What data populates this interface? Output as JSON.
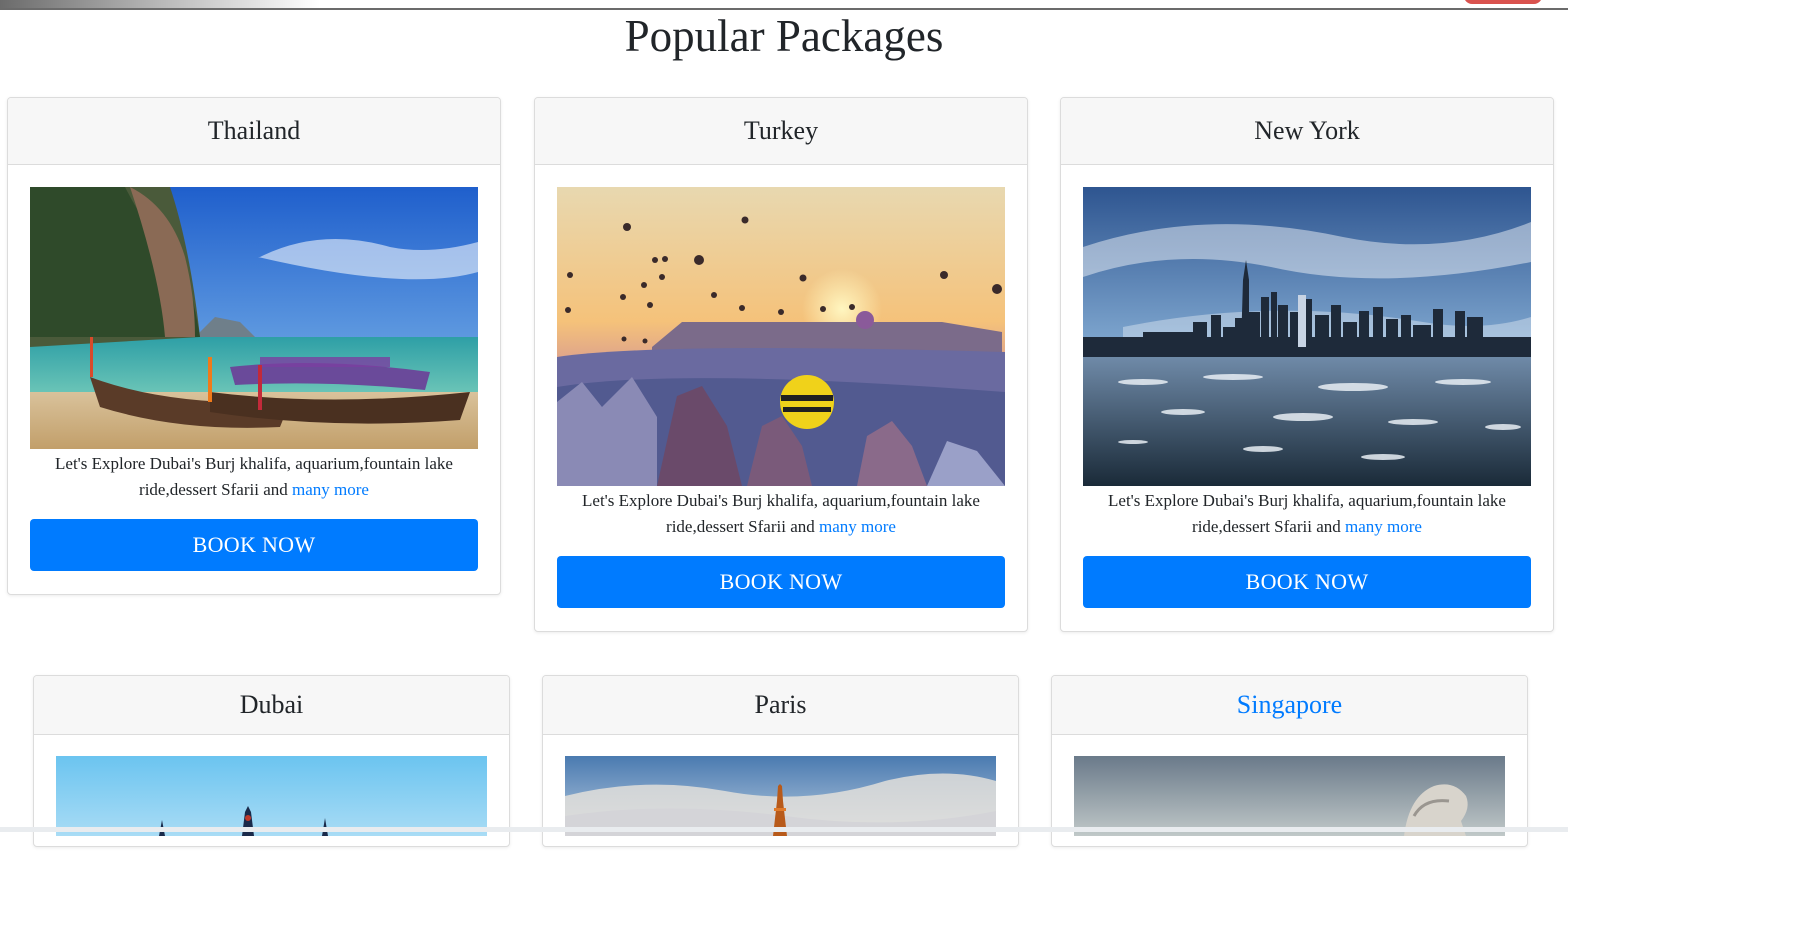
{
  "page": {
    "title": "Popular Packages"
  },
  "cards": [
    {
      "name": "Thailand",
      "desc": "Let's Explore Dubai's Burj khalifa, aquarium,fountain lake ride,dessert Sfarii and",
      "link": "many more",
      "button": "BOOK NOW"
    },
    {
      "name": "Turkey",
      "desc": "Let's Explore Dubai's Burj khalifa, aquarium,fountain lake ride,dessert Sfarii and",
      "link": "many more",
      "button": "BOOK NOW"
    },
    {
      "name": "New York",
      "desc": "Let's Explore Dubai's Burj khalifa, aquarium,fountain lake ride,dessert Sfarii and",
      "link": "many more",
      "button": "BOOK NOW"
    },
    {
      "name": "Dubai"
    },
    {
      "name": "Paris"
    },
    {
      "name": "Singapore"
    }
  ],
  "colors": {
    "accent": "#007bff",
    "header_bg": "#f7f7f7",
    "text": "#212529"
  }
}
